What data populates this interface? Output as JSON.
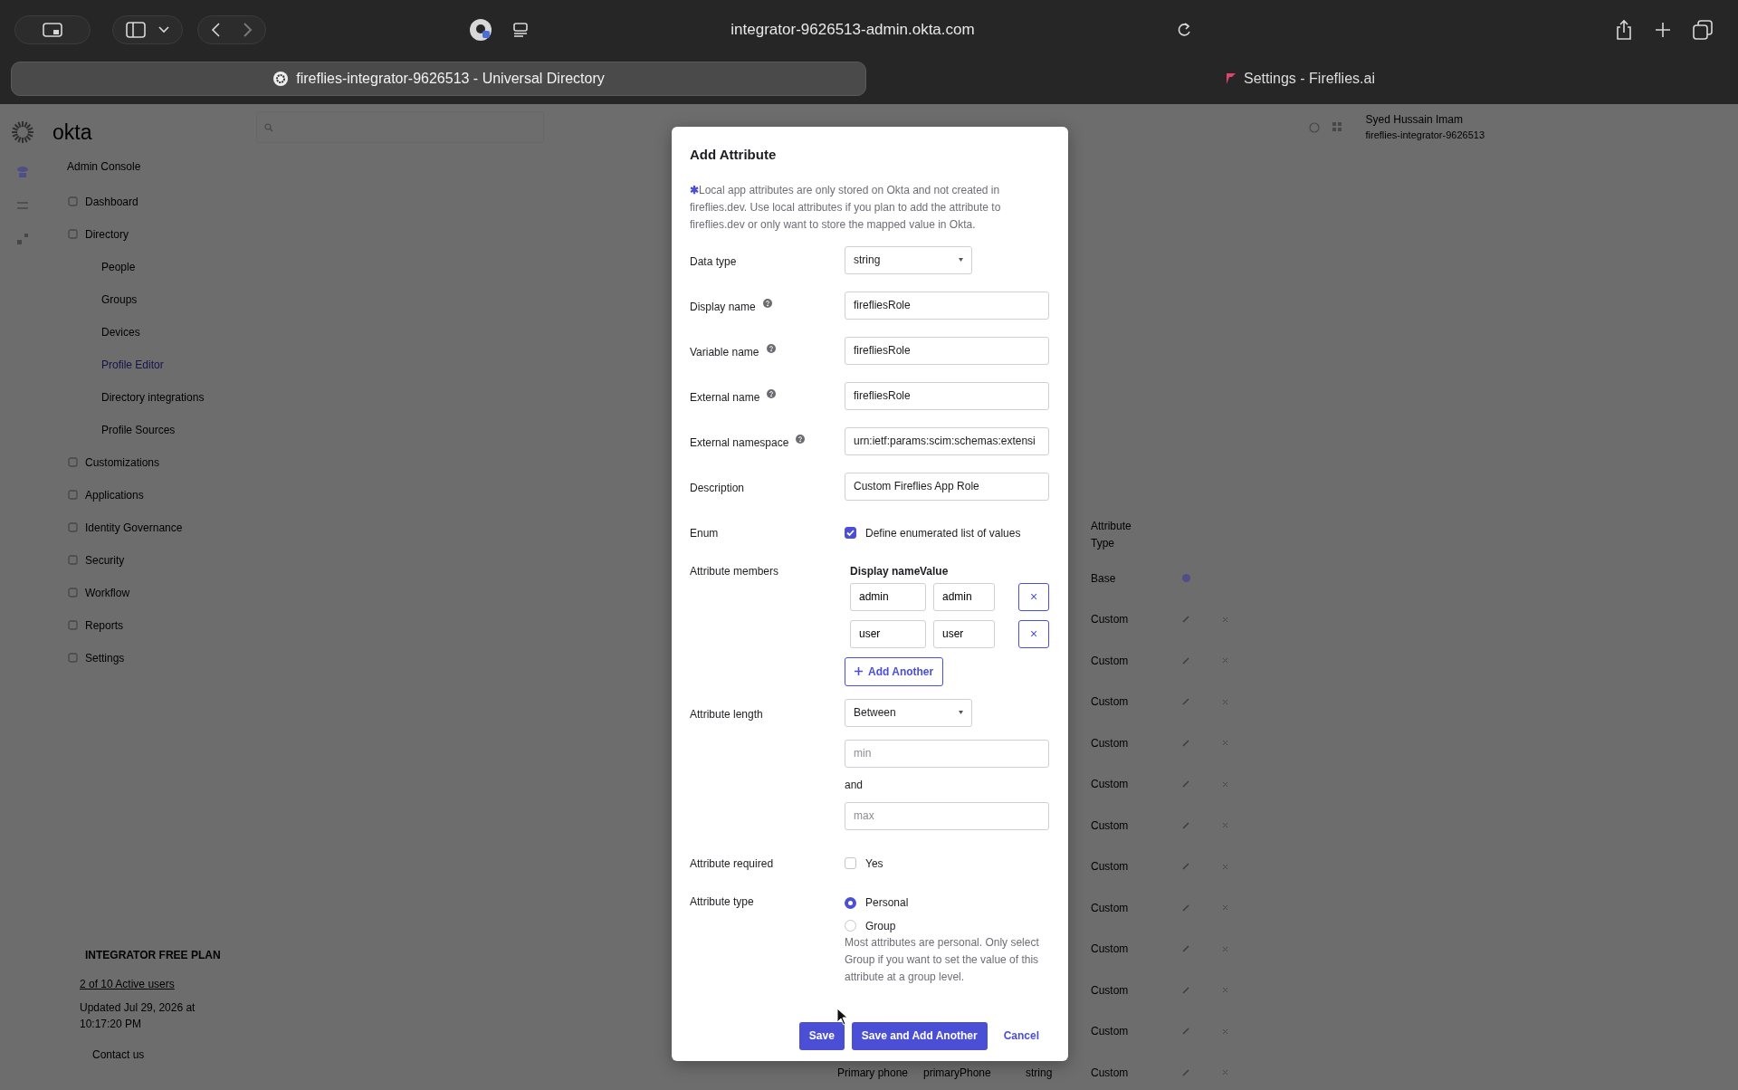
{
  "browser": {
    "url": "integrator-9626513-admin.okta.com",
    "tabs": [
      {
        "title": "fireflies-integrator-9626513 - Universal Directory",
        "selected": true
      },
      {
        "title": "Settings - Fireflies.ai",
        "selected": false
      }
    ]
  },
  "header": {
    "logo": "okta",
    "user_name": "Syed Hussain Imam",
    "user_org": "fireflies-integrator-9626513"
  },
  "sidebar": {
    "heading": "Admin Console",
    "items": [
      {
        "label": "Dashboard",
        "selected": false
      },
      {
        "label": "Directory",
        "selected": false,
        "children": [
          {
            "label": "People",
            "selected": false
          },
          {
            "label": "Groups",
            "selected": false
          },
          {
            "label": "Devices",
            "selected": false
          },
          {
            "label": "Profile Editor",
            "selected": true
          },
          {
            "label": "Directory integrations",
            "selected": false
          },
          {
            "label": "Profile Sources",
            "selected": false
          }
        ]
      },
      {
        "label": "Customizations",
        "selected": false
      },
      {
        "label": "Applications",
        "selected": false
      },
      {
        "label": "Identity Governance",
        "selected": false
      },
      {
        "label": "Security",
        "selected": false
      },
      {
        "label": "Workflow",
        "selected": false
      },
      {
        "label": "Reports",
        "selected": false
      },
      {
        "label": "Settings",
        "selected": false
      }
    ]
  },
  "plan": {
    "title": "INTEGRATOR FREE PLAN",
    "users": "2 of 10 Active users",
    "updated": "Updated Jul 29, 2026 at 10:17:20 PM",
    "contact": "Contact us"
  },
  "table": {
    "column_header": "Attribute Type",
    "rows": [
      {
        "attribute_type": "Base",
        "kind": "base"
      },
      {
        "attribute_type": "Custom",
        "kind": "custom"
      },
      {
        "attribute_type": "Custom",
        "kind": "custom"
      },
      {
        "attribute_type": "Custom",
        "kind": "custom"
      },
      {
        "attribute_type": "Custom",
        "kind": "custom"
      },
      {
        "attribute_type": "Custom",
        "kind": "custom"
      },
      {
        "attribute_type": "Custom",
        "kind": "custom"
      },
      {
        "attribute_type": "Custom",
        "kind": "custom"
      },
      {
        "attribute_type": "Custom",
        "kind": "custom"
      },
      {
        "attribute_type": "Custom",
        "kind": "custom"
      },
      {
        "attribute_type": "Custom",
        "kind": "custom"
      },
      {
        "attribute_type": "Custom",
        "kind": "custom"
      },
      {
        "display_name": "Primary phone",
        "variable_name": "primaryPhone",
        "data_type": "string",
        "attribute_type": "Custom",
        "kind": "custom"
      }
    ]
  },
  "modal": {
    "title": "Add Attribute",
    "note_mark": "✱",
    "note": "Local app attributes are only stored on Okta and not created in fireflies.dev. Use local attributes if you plan to add the attribute to fireflies.dev or only want to store the mapped value in Okta.",
    "fields": [
      {
        "kind": "select",
        "label": "Data type",
        "help": false,
        "value": "string"
      },
      {
        "kind": "text",
        "label": "Display name",
        "help": true,
        "value": "firefliesRole"
      },
      {
        "kind": "text",
        "label": "Variable name",
        "help": true,
        "value": "firefliesRole"
      },
      {
        "kind": "text",
        "label": "External name",
        "help": true,
        "value": "firefliesRole"
      },
      {
        "kind": "text",
        "label": "External namespace",
        "help": true,
        "value": "urn:ietf:params:scim:schemas:extensi"
      },
      {
        "kind": "text",
        "label": "Description",
        "help": false,
        "value": "Custom Fireflies App Role"
      },
      {
        "kind": "checkbox",
        "label": "Enum",
        "option": "Define enumerated list of values",
        "checked": true
      },
      {
        "kind": "members",
        "label": "Attribute members",
        "headers": [
          "Display name",
          "Value"
        ],
        "remove_label": "×",
        "add_label": "Add Another",
        "members": [
          {
            "display_name": "admin",
            "value": "admin"
          },
          {
            "display_name": "user",
            "value": "user"
          }
        ]
      },
      {
        "kind": "range",
        "label": "Attribute length",
        "value": "Between",
        "min_placeholder": "min",
        "joiner": "and",
        "max_placeholder": "max"
      },
      {
        "kind": "checkbox",
        "label": "Attribute required",
        "option": "Yes",
        "checked": false
      },
      {
        "kind": "radio",
        "label": "Attribute type",
        "options": [
          {
            "label": "Personal",
            "selected": true
          },
          {
            "label": "Group",
            "selected": false
          }
        ],
        "hint": "Most attributes are personal. Only select Group if you want to set the value of this attribute at a group level."
      }
    ],
    "buttons": [
      {
        "label": "Save",
        "kind": "primary"
      },
      {
        "label": "Save and Add Another",
        "kind": "primary"
      },
      {
        "label": "Cancel",
        "kind": "link"
      }
    ]
  }
}
